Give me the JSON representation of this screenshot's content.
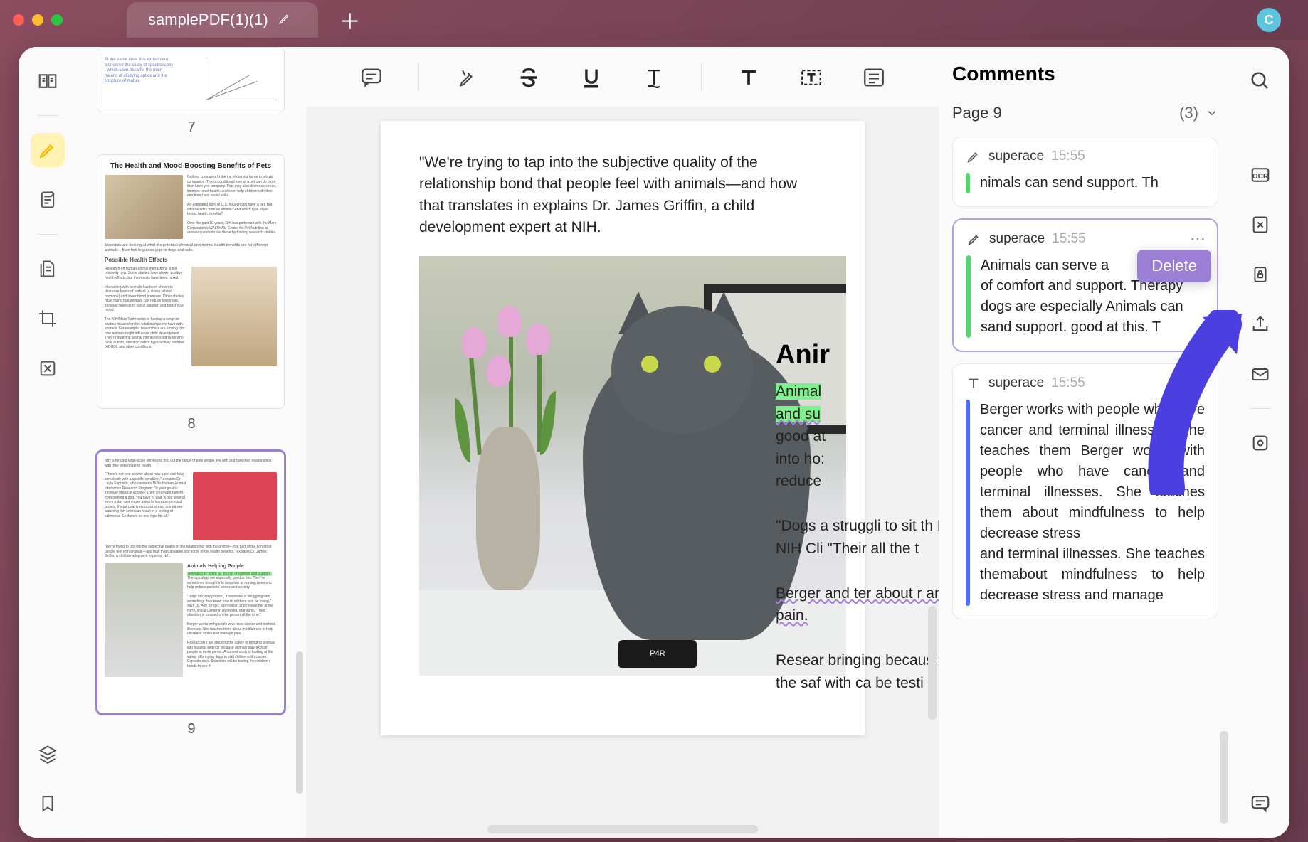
{
  "window": {
    "tab_title": "samplePDF(1)(1)",
    "avatar_letter": "C"
  },
  "left_rail": {
    "items": [
      "reader",
      "highlighter",
      "notes",
      "files",
      "crop",
      "stamp"
    ],
    "bottom": [
      "layers",
      "bookmark"
    ]
  },
  "thumbnails": {
    "pages": [
      {
        "num": "7"
      },
      {
        "num": "8",
        "title": "The Health and Mood-Boosting Benefits of Pets",
        "sub1": "Possible Health Effects"
      },
      {
        "num": "9"
      }
    ],
    "selected": 9
  },
  "toolbar": {
    "items": [
      "comment",
      "highlight",
      "strikethrough",
      "underline",
      "text-style",
      "add-text",
      "text-box",
      "list"
    ]
  },
  "page": {
    "quote": "\"We're trying to tap into the subjective quality of the relationship bond that people feel with animals—and how that translates in explains Dr. James Griffin, a child development expert at NIH.",
    "section_heading": "Anir",
    "hl1": "Animal",
    "hl2": "and su",
    "p1a": "good at",
    "p1b": "into ho:",
    "p1c": "reduce",
    "p2": "\"Dogs a struggli to sit th Berger, NIH Cli \"Their all the t",
    "p3": "Berger and ter about r and ma pain.",
    "p4": "Resear bringing becaus more g the saf with ca be testi",
    "router_label": "P4R"
  },
  "comments": {
    "title": "Comments",
    "page_label": "Page 9",
    "count": "(3)",
    "delete_label": "Delete",
    "items": [
      {
        "user": "superace",
        "time": "15:55",
        "bar": "green",
        "text": "nimals can send support. Th",
        "icon": "highlighter"
      },
      {
        "user": "superace",
        "time": "15:55",
        "bar": "green",
        "text": "Animals can serve a\nof comfort and support. Therapy dogs are especially Animals can sand support. good at this. T",
        "icon": "highlighter",
        "selected": true
      },
      {
        "user": "superace",
        "time": "15:55",
        "bar": "blue",
        "text": "Berger works with people who have cancer and terminal illnesses. She teaches them Berger works with people who have cancer and terminal illnesses. She teaches them about mindfulness to help decrease stress\nand terminal illnesses. She teaches themabout mindfulness to help decrease stress and manage",
        "icon": "text"
      }
    ]
  },
  "right_rail": {
    "items": [
      "search",
      "ocr",
      "convert",
      "protect",
      "share",
      "mail",
      "settings",
      "comments-panel"
    ]
  }
}
